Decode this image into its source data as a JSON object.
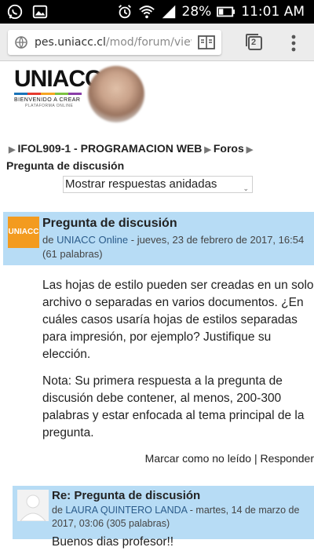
{
  "status_bar": {
    "battery": "28%",
    "time": "11:01 AM"
  },
  "browser": {
    "url_host": "pes.uniacc.cl",
    "url_path": "/mod/forum/view",
    "tab_count": "2"
  },
  "site": {
    "logo_text": "UNIACC",
    "logo_tagline": "BIENVENIDO A CREAR",
    "logo_subtagline": "PLATAFORMA ONLINE",
    "logo_colors": [
      "#1a73b8",
      "#e63a2e",
      "#f5a623",
      "#7cc242",
      "#8a3ea8"
    ]
  },
  "breadcrumb": {
    "course": "IFOL909-1 - PROGRAMACION WEB",
    "forums": "Foros",
    "current": "Pregunta de discusión"
  },
  "display_mode": {
    "selected": "Mostrar respuestas anidadas"
  },
  "post": {
    "avatar_label": "UNIACC",
    "title": "Pregunta de discusión",
    "by": "de",
    "author": "UNIACC Online",
    "date": "- jueves, 23 de febrero de 2017, 16:54",
    "words": "(61 palabras)",
    "body_1": "Las hojas de estilo pueden ser creadas en un solo archivo o separadas en varios documentos. ¿En cuáles casos usaría hojas de estilos separadas para impresión, por ejemplo? Justifique su elección.",
    "body_2": "Nota: Su primera respuesta a la pregunta de discusión debe contener, al menos, 200-300 palabras y estar enfocada al tema principal de la pregunta.",
    "mark_unread": "Marcar como no leído",
    "separator": "|",
    "reply": "Responder"
  },
  "reply": {
    "title": "Re: Pregunta de discusión",
    "by": "de",
    "author": "LAURA QUINTERO LANDA",
    "date": "- martes, 14 de marzo de 2017, 03:06",
    "words": "(305 palabras)",
    "body_start": "Buenos dias profesor!!"
  },
  "colors": {
    "post_header_bg": "#b7dcf5",
    "link": "#2a5b8a",
    "avatar_orange": "#f39b1f"
  }
}
